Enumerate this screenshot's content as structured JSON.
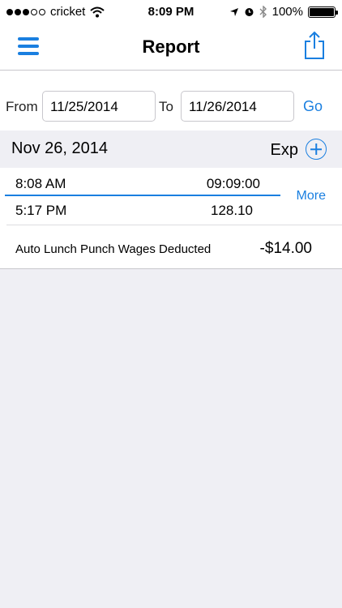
{
  "status_bar": {
    "carrier": "cricket",
    "time": "8:09 PM",
    "battery": "100%",
    "signal_bars_filled": 3,
    "signal_bars_total": 5
  },
  "nav": {
    "title": "Report"
  },
  "range": {
    "from_label": "From",
    "from_value": "11/25/2014",
    "to_label": "To",
    "to_value": "11/26/2014",
    "go_label": "Go"
  },
  "day": {
    "date": "Nov 26, 2014",
    "exp_label": "Exp"
  },
  "entries": {
    "clock_in": "8:08 AM",
    "duration": "09:09:00",
    "clock_out": "5:17 PM",
    "amount": "128.10",
    "more_label": "More"
  },
  "deduction": {
    "label": "Auto Lunch Punch Wages Deducted",
    "amount": "-$14.00"
  },
  "colors": {
    "accent": "#1a7fe0",
    "background": "#efeff4"
  }
}
